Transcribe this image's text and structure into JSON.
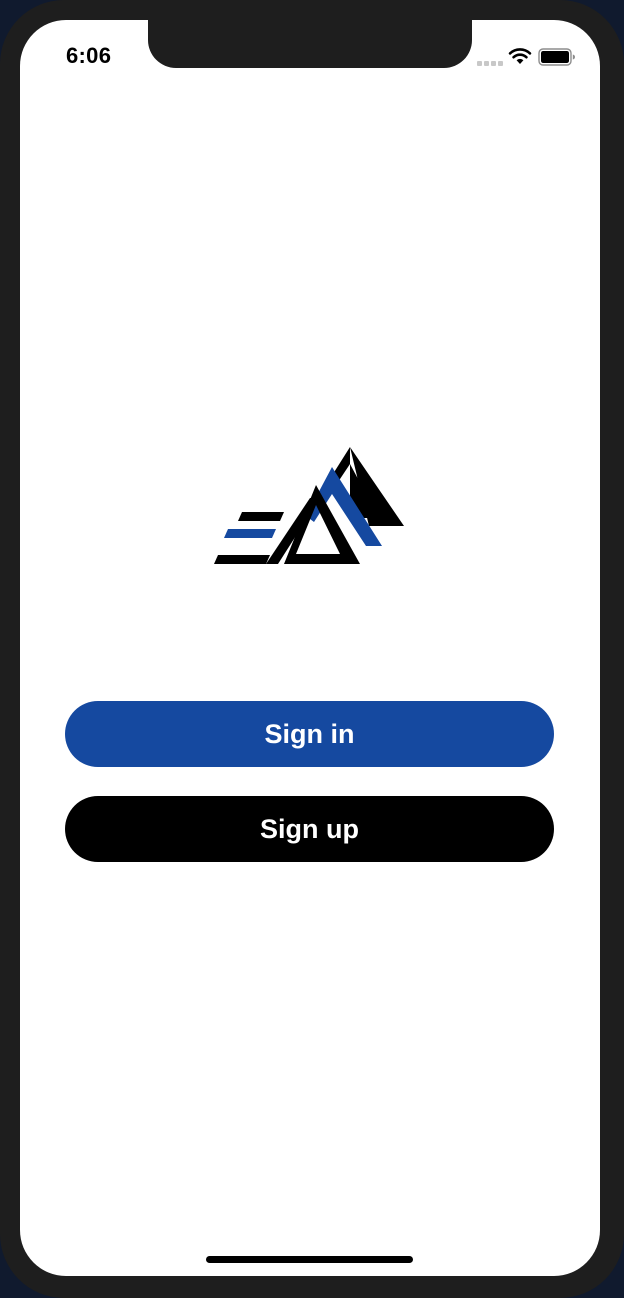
{
  "status_bar": {
    "time": "6:06",
    "icons": [
      "signal-icon",
      "wifi-icon",
      "battery-icon"
    ]
  },
  "logo": {
    "icon": "mountain-logo",
    "colors": {
      "primary": "#000000",
      "accent": "#1549a0"
    }
  },
  "actions": {
    "sign_in_label": "Sign in",
    "sign_up_label": "Sign up"
  },
  "colors": {
    "sign_in_bg": "#1549a0",
    "sign_up_bg": "#000000",
    "button_text": "#ffffff"
  }
}
